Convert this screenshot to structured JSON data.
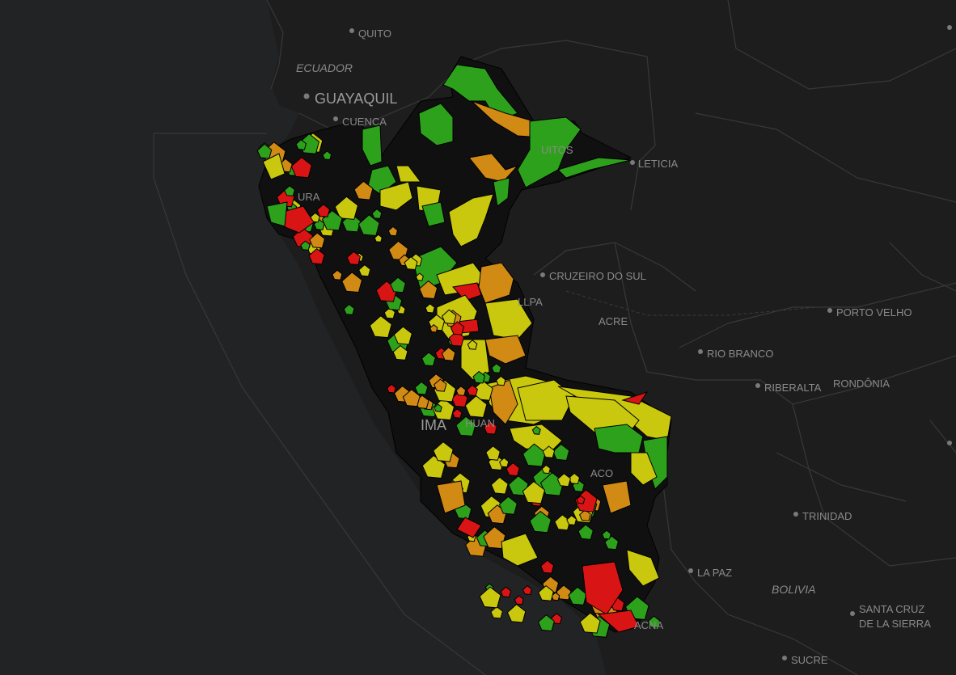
{
  "colors": {
    "background": "#191a1a",
    "land": "#1f1f1f",
    "ocean": "#222324",
    "borders": "#3a3a3a",
    "peru_base": "#101010",
    "high": "#2ea11c",
    "mid_high": "#c9c80e",
    "mid_low": "#d18a14",
    "low": "#d91414"
  },
  "cities": [
    {
      "id": "quito",
      "name": "QUITO"
    },
    {
      "id": "guayaquil",
      "name": "GUAYAQUIL"
    },
    {
      "id": "cuenca",
      "name": "CUENCA"
    },
    {
      "id": "leticia",
      "name": "LETICIA"
    },
    {
      "id": "cruzeiro",
      "name": "CRUZEIRO DO SUL"
    },
    {
      "id": "porto-velho",
      "name": "PORTO VELHO"
    },
    {
      "id": "rio-branco",
      "name": "RIO BRANCO"
    },
    {
      "id": "riberalta",
      "name": "RIBERALTA"
    },
    {
      "id": "trinidad",
      "name": "TRINIDAD"
    },
    {
      "id": "la-paz",
      "name": "LA PAZ"
    },
    {
      "id": "santa-cruz",
      "name": "SANTA CRUZ"
    },
    {
      "id": "santa-cruz-2",
      "name": "DE LA SIERRA"
    },
    {
      "id": "sucre",
      "name": "SUCRE"
    }
  ],
  "regions": [
    {
      "id": "ecuador",
      "name": "ECUADOR"
    },
    {
      "id": "acre",
      "name": "ACRE"
    },
    {
      "id": "rondonia",
      "name": "RONDÔNIA"
    },
    {
      "id": "bolivia",
      "name": "BOLIVIA"
    }
  ],
  "partial_labels": [
    {
      "id": "iquitos",
      "text": "UITOS"
    },
    {
      "id": "piura",
      "text": "URA"
    },
    {
      "id": "pucallpa",
      "text": "LLPA"
    },
    {
      "id": "lima",
      "text": "IMA"
    },
    {
      "id": "huancayo",
      "text": "HUAN"
    },
    {
      "id": "cusco",
      "text": "ACO"
    },
    {
      "id": "tacna",
      "text": "ACNA"
    }
  ]
}
